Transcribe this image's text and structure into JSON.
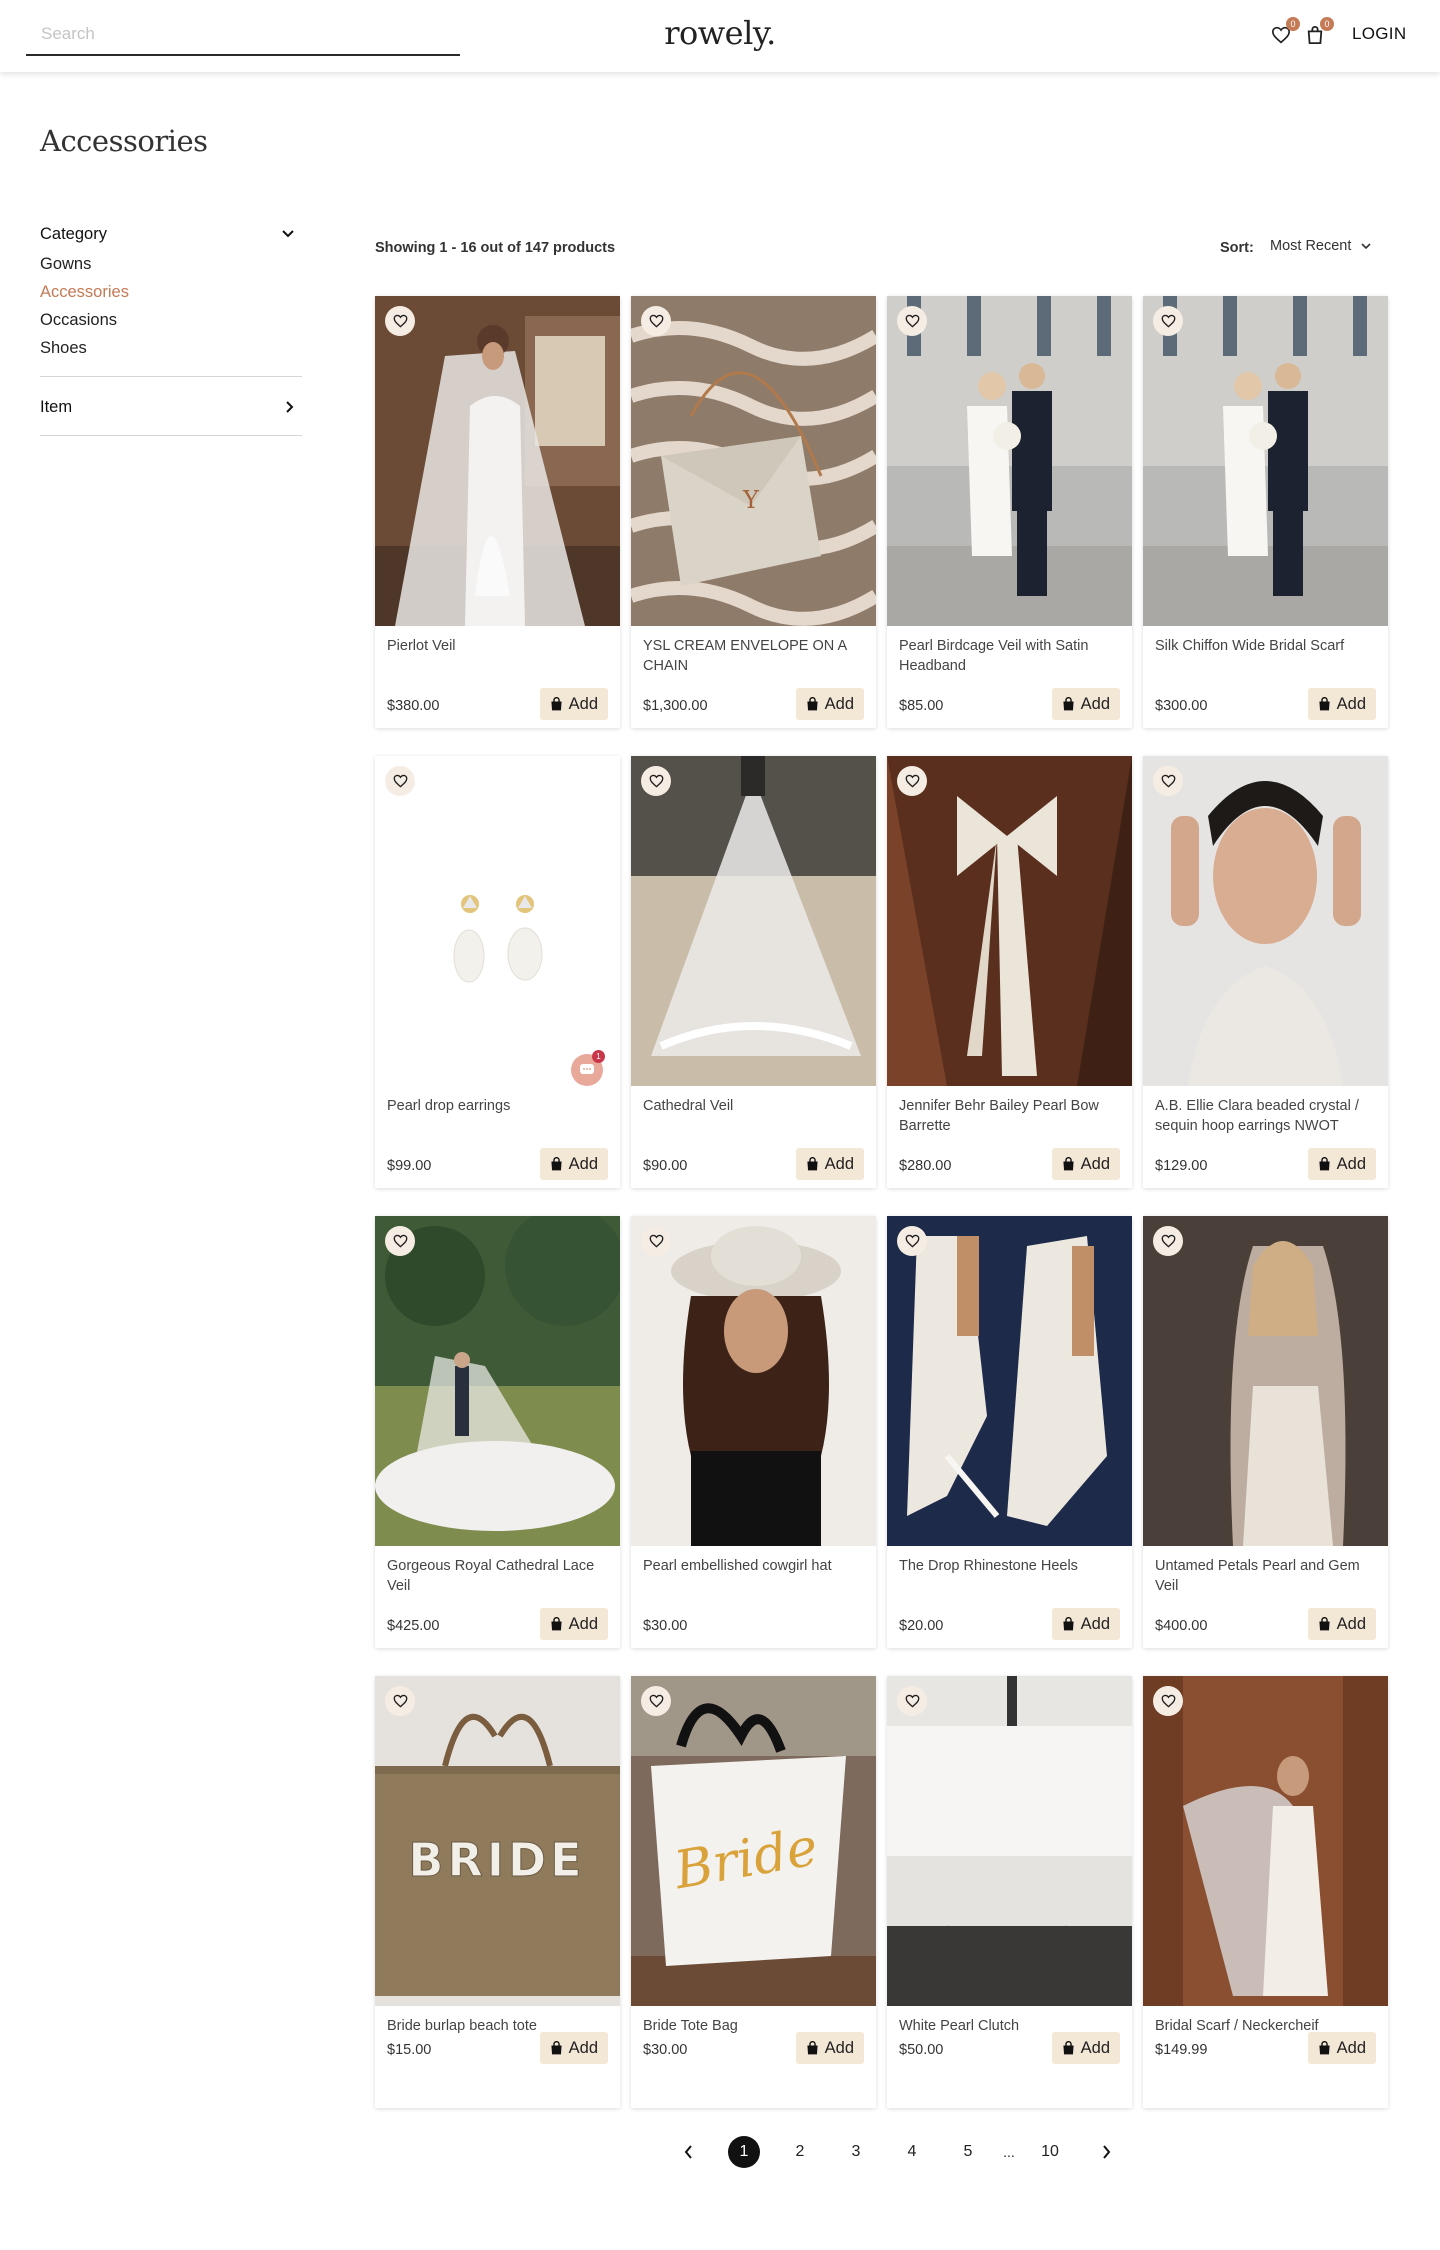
{
  "header": {
    "search_placeholder": "Search",
    "logo": "rowely.",
    "wishlist_count": "0",
    "cart_count": "0",
    "login_label": "LOGIN"
  },
  "page": {
    "title": "Accessories"
  },
  "sidebar": {
    "category_label": "Category",
    "categories": [
      "Gowns",
      "Accessories",
      "Occasions",
      "Shoes"
    ],
    "active_category": "Accessories",
    "item_label": "Item"
  },
  "toolbar": {
    "showing_text": "Showing 1 - 16 out of 147 products",
    "sort_label": "Sort:",
    "sort_value": "Most Recent"
  },
  "products": [
    {
      "name": "Pierlot Veil",
      "price": "$380.00",
      "add_label": "Add"
    },
    {
      "name": "YSL CREAM ENVELOPE ON A CHAIN",
      "price": "$1,300.00",
      "add_label": "Add"
    },
    {
      "name": "Pearl Birdcage Veil with Satin Headband",
      "price": "$85.00",
      "add_label": "Add"
    },
    {
      "name": "Silk Chiffon Wide Bridal Scarf",
      "price": "$300.00",
      "add_label": "Add"
    },
    {
      "name": "Pearl drop earrings",
      "price": "$99.00",
      "add_label": "Add"
    },
    {
      "name": "Cathedral Veil",
      "price": "$90.00",
      "add_label": "Add"
    },
    {
      "name": "Jennifer Behr Bailey Pearl Bow Barrette",
      "price": "$280.00",
      "add_label": "Add"
    },
    {
      "name": "A.B. Ellie Clara beaded crystal / sequin hoop earrings NWOT",
      "price": "$129.00",
      "add_label": "Add"
    },
    {
      "name": "Gorgeous Royal Cathedral Lace Veil",
      "price": "$425.00",
      "add_label": "Add"
    },
    {
      "name": "Pearl embellished cowgirl hat",
      "price": "$30.00",
      "add_label": ""
    },
    {
      "name": "The Drop Rhinestone Heels",
      "price": "$20.00",
      "add_label": "Add"
    },
    {
      "name": "Untamed Petals Pearl and Gem Veil",
      "price": "$400.00",
      "add_label": "Add"
    },
    {
      "name": "Bride burlap beach tote",
      "price": "$15.00",
      "add_label": "Add"
    },
    {
      "name": "Bride Tote Bag",
      "price": "$30.00",
      "add_label": "Add"
    },
    {
      "name": "White Pearl Clutch",
      "price": "$50.00",
      "add_label": "Add"
    },
    {
      "name": "Bridal Scarf / Neckercheif",
      "price": "$149.99",
      "add_label": "Add"
    }
  ],
  "chat_badge": "1",
  "image_text": {
    "tote_burlap": "BRIDE",
    "tote_canvas": "Bride"
  },
  "pagination": {
    "pages": [
      "1",
      "2",
      "3",
      "4",
      "5"
    ],
    "ellipsis": "...",
    "last": "10",
    "current": "1"
  },
  "colors": {
    "accent": "#c47a55",
    "add_button_bg": "#f3e7d6",
    "fav_bg": "#f5ede3"
  },
  "icons": {
    "wishlist": "heart-icon",
    "cart": "shopping-bag-icon",
    "expand": "chevron-down-icon",
    "collapse": "chevron-right-icon",
    "favorite": "heart-icon",
    "add": "shopping-bag-icon",
    "chat": "chat-bubble-icon",
    "prev": "chevron-left-icon",
    "next": "chevron-right-icon"
  }
}
